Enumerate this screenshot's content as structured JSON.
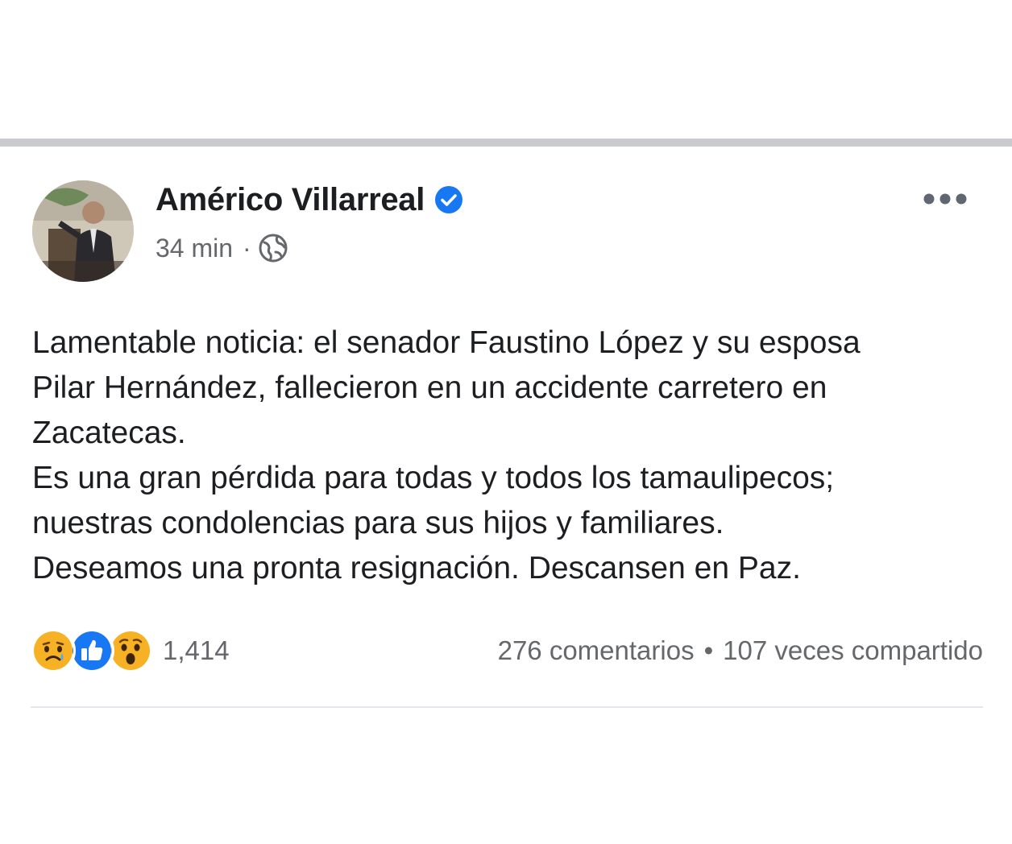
{
  "post": {
    "author": "Américo Villarreal",
    "time": "34 min",
    "separator": "·",
    "text": "Lamentable noticia: el senador Faustino López y su esposa\nPilar Hernández, fallecieron en un accidente carretero en\nZacatecas.\nEs una gran pérdida para todas y todos los tamaulipecos;\nnuestras condolencias para sus hijos y familiares.\nDeseamos una pronta resignación. Descansen en Paz.",
    "reactions": {
      "icons": [
        "sad-reaction-icon",
        "like-reaction-icon",
        "wow-reaction-icon"
      ],
      "count": "1,414"
    },
    "comments": "276 comentarios",
    "bullet": "•",
    "shares": "107 veces compartido"
  },
  "colors": {
    "verified": "#1877f2",
    "like": "#1877f2",
    "emoji": "#f7b125",
    "meta_text": "#65676b",
    "divider": "#c9cbce"
  }
}
